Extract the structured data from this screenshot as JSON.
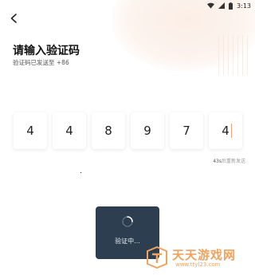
{
  "status_bar": {
    "time": "3:13"
  },
  "page": {
    "title": "请输入验证码",
    "subtitle": "验证码已发送至 +86"
  },
  "code_digits": [
    "4",
    "4",
    "8",
    "9",
    "7",
    "4"
  ],
  "resend": {
    "countdown": "43s",
    "label": "后重新发送"
  },
  "toast": {
    "text": "验证中..."
  },
  "watermark": {
    "name": "天天游戏网",
    "url": "www.ttyl23.com"
  },
  "colors": {
    "accent": "#f2a25c",
    "toast_bg": "#2c3e50",
    "caret": "#f1a27a"
  }
}
